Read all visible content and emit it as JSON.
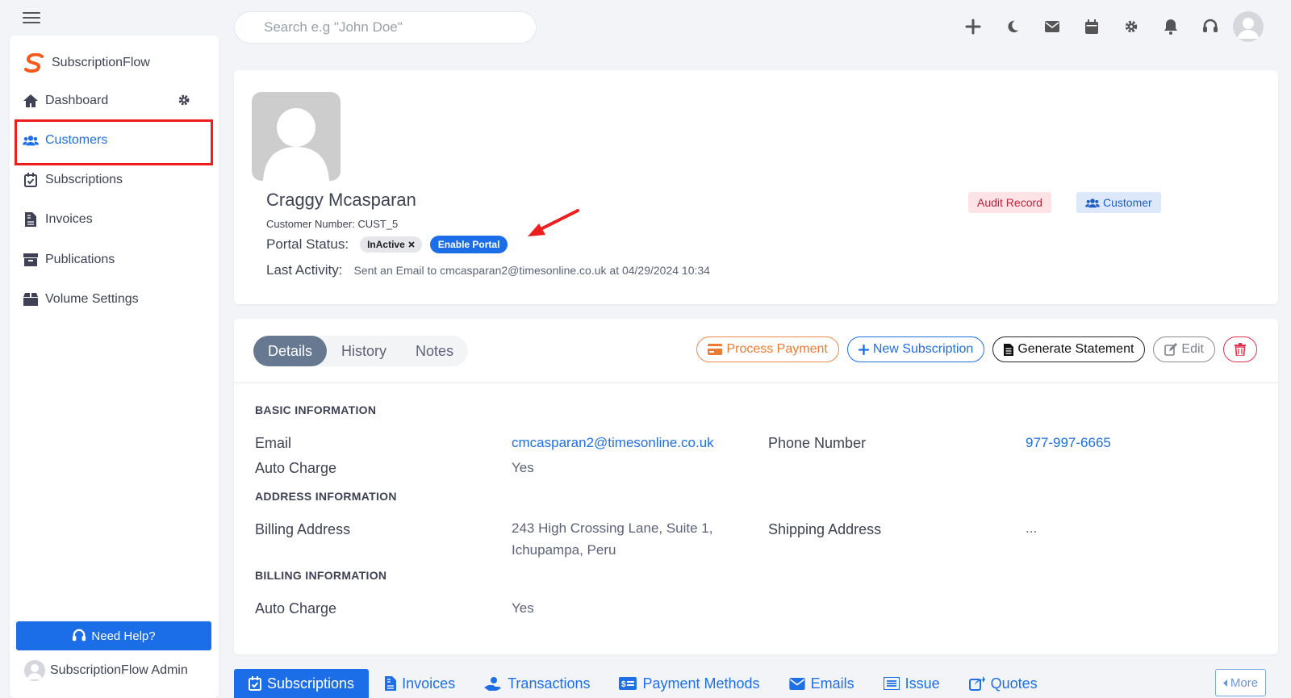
{
  "app": {
    "brand": "SubscriptionFlow"
  },
  "search": {
    "placeholder": "Search e.g \"John Doe\""
  },
  "topbar": {
    "icons": [
      "plus-icon",
      "moon-icon",
      "envelope-icon",
      "calendar-icon",
      "gear-icon",
      "bell-icon",
      "headset-icon",
      "user-avatar"
    ]
  },
  "sidebar": {
    "items": [
      {
        "label": "Dashboard",
        "icon": "home-icon"
      },
      {
        "label": "Customers",
        "icon": "users-icon",
        "active": true
      },
      {
        "label": "Subscriptions",
        "icon": "calendar-check-icon"
      },
      {
        "label": "Invoices",
        "icon": "file-invoice-icon"
      },
      {
        "label": "Publications",
        "icon": "archive-icon"
      },
      {
        "label": "Volume Settings",
        "icon": "box-icon"
      }
    ],
    "help_label": "Need Help?",
    "admin_name": "SubscriptionFlow Admin"
  },
  "profile": {
    "name": "Craggy Mcasparan",
    "customer_number": "Customer Number: CUST_5",
    "portal_status_label": "Portal Status:",
    "portal_status": "InActive",
    "enable_portal_label": "Enable Portal",
    "last_activity_label": "Last Activity:",
    "last_activity": "Sent an Email to cmcasparan2@timesonline.co.uk at 04/29/2024 10:34",
    "tags": {
      "audit": "Audit Record",
      "customer": "Customer"
    }
  },
  "details": {
    "tabs": [
      "Details",
      "History",
      "Notes"
    ],
    "actions": {
      "process_payment": "Process Payment",
      "new_subscription": "New Subscription",
      "generate_statement": "Generate Statement",
      "edit": "Edit"
    },
    "sections": {
      "basic": "BASIC INFORMATION",
      "address": "ADDRESS INFORMATION",
      "billing": "BILLING INFORMATION"
    },
    "fields": {
      "email_label": "Email",
      "email_value": "cmcasparan2@timesonline.co.uk",
      "phone_label": "Phone Number",
      "phone_value": "977-997-6665",
      "auto_charge_label": "Auto Charge",
      "auto_charge_value": "Yes",
      "billing_address_label": "Billing Address",
      "billing_address_line1": "243 High Crossing Lane, Suite 1,",
      "billing_address_line2": "Ichupampa, Peru",
      "shipping_address_label": "Shipping Address",
      "shipping_address_value": "...",
      "billing_auto_charge_label": "Auto Charge",
      "billing_auto_charge_value": "Yes"
    }
  },
  "bottom_tabs": {
    "items": [
      "Subscriptions",
      "Invoices",
      "Transactions",
      "Payment Methods",
      "Emails",
      "Issue",
      "Quotes"
    ],
    "more_label": "More"
  },
  "colors": {
    "primary": "#1b6ee8",
    "highlight_box": "#ef1e1e",
    "audit_bg": "#fde3e6",
    "audit_text": "#c4213a",
    "tab_active": "#677991",
    "process_payment": "#ec7a33",
    "delete": "#e0314b"
  }
}
